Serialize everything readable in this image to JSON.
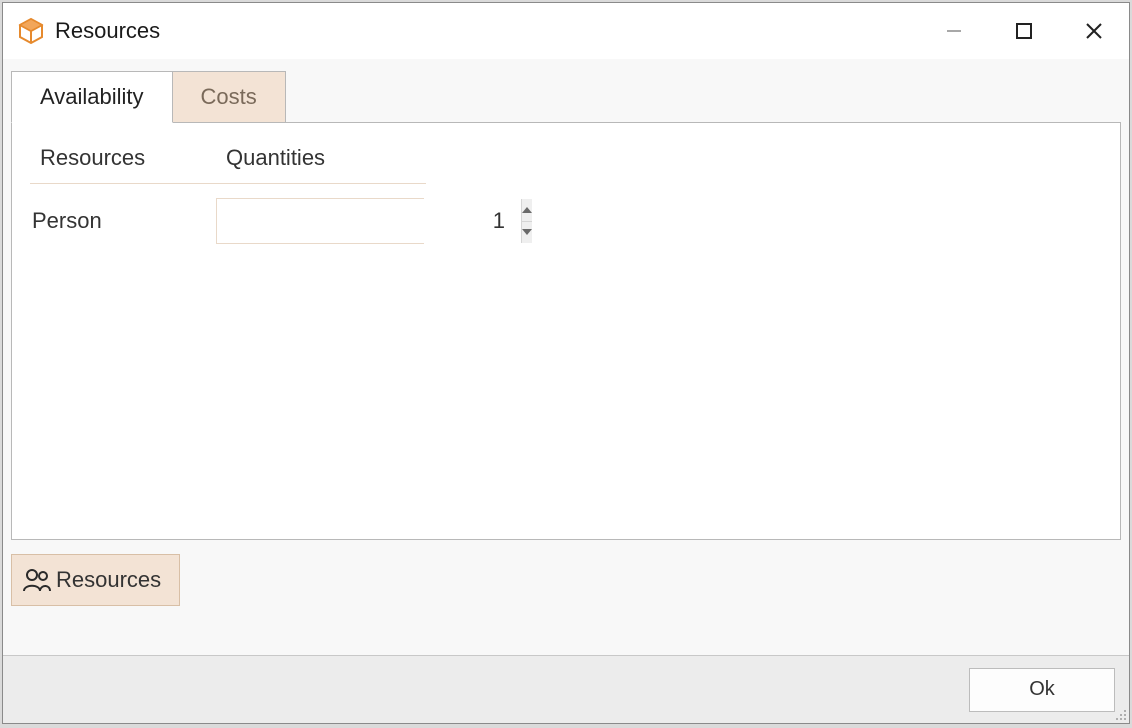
{
  "window": {
    "title": "Resources"
  },
  "tabs": {
    "availability": "Availability",
    "costs": "Costs"
  },
  "columns": {
    "resources": "Resources",
    "quantities": "Quantities"
  },
  "rows": [
    {
      "label": "Person",
      "value": "1"
    }
  ],
  "buttons": {
    "resources": "Resources",
    "ok": "Ok"
  }
}
